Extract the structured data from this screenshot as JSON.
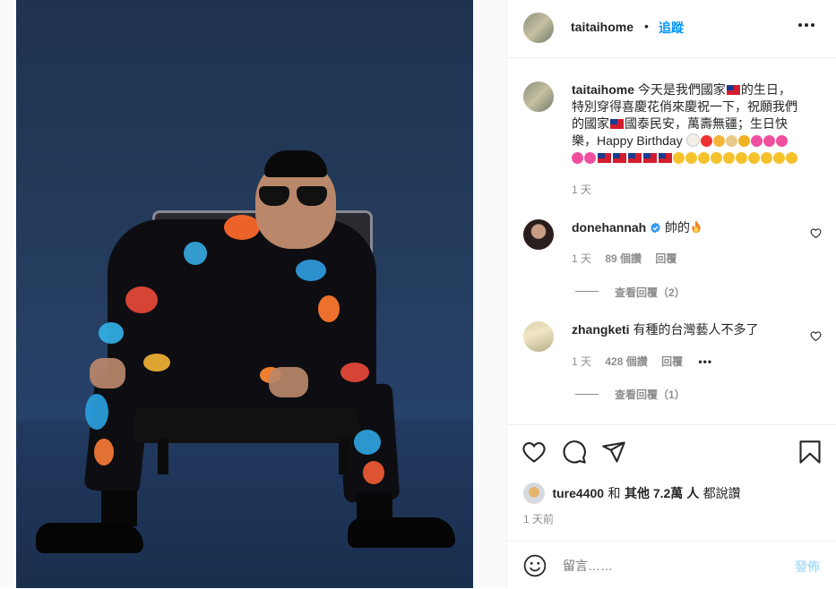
{
  "post": {
    "username": "taitaihome",
    "follow_label": "追蹤",
    "caption_text": "今天是我們國家🇹🇼的生日，特別穿得喜慶花俏來慶祝一下，祝願我們的國家🇹🇼國泰民安，萬壽無疆；生日快樂，Happy Birthday 🎂🎈🎉🎊🥇💖💖💖💖💖🇹🇼🇹🇼🇹🇼🇹🇼🇹🇼👍👍👍👍👍💪💪💪💪💪",
    "caption_lines": [
      "今天是我們國家",
      "的生日，",
      "特別穿得喜慶花俏來慶祝一下，祝願我們",
      "的國家",
      "國泰民安，萬壽無疆；生日快",
      "樂，Happy Birthday"
    ],
    "caption_time": "1 天"
  },
  "comments": [
    {
      "username": "donehannah",
      "text": "帥的🔥",
      "text_plain": "帥的",
      "time": "1 天",
      "likes": "89 個讚",
      "reply_label": "回覆",
      "view_replies": "查看回覆（2）"
    },
    {
      "username": "zhangketi",
      "text": "有種的台灣藝人不多了",
      "time": "1 天",
      "likes": "428 個讚",
      "reply_label": "回覆",
      "view_replies": "查看回覆（1）"
    }
  ],
  "likes_summary": {
    "liker": "ture4400",
    "conj": "和",
    "others": "其他 7.2萬 人",
    "suffix": "都說讚"
  },
  "post_time": "1 天前",
  "add_comment": {
    "placeholder": "留言……",
    "submit_label": "發佈"
  },
  "icons": {
    "more": "more-horizontal-icon",
    "like": "heart-icon",
    "comment": "comment-bubble-icon",
    "share": "paper-plane-icon",
    "save": "bookmark-icon",
    "emoji": "smiley-icon",
    "verified": "verified-badge-icon"
  },
  "colors": {
    "link_blue": "#0095f6",
    "text": "#262626",
    "secondary": "#8e8e8e",
    "submit_disabled": "#b2dffc",
    "photo_backdrop": "#243c5d"
  }
}
